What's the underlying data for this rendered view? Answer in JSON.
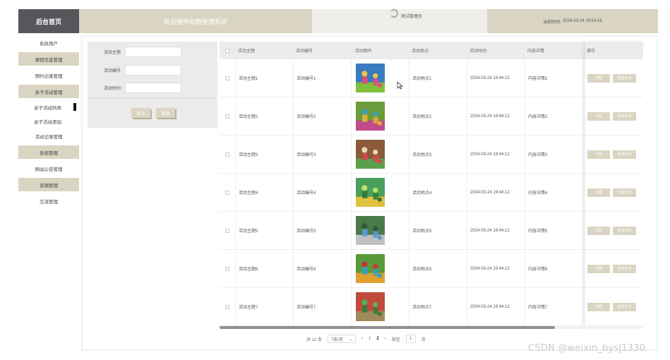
{
  "header": {
    "brand": "后台首页",
    "welcome": "欢迎使用幼教管理系统",
    "user": "测试管理员",
    "time_label": "当前时间:",
    "time_value": "2024-03-24 19:54:16"
  },
  "sidebar": {
    "items": [
      {
        "label": "系统用户",
        "style": "plain"
      },
      {
        "label": "课程信息管理",
        "style": "tan"
      },
      {
        "label": "预约记录管理",
        "style": "plain"
      },
      {
        "label": "亲子活动管理",
        "style": "tan"
      },
      {
        "label": "亲子活动列表",
        "style": "sub",
        "active": true
      },
      {
        "label": "亲子活动添加",
        "style": "sub"
      },
      {
        "label": "活动记录管理",
        "style": "plain"
      },
      {
        "label": "系统管理",
        "style": "tan"
      },
      {
        "label": "网站公告管理",
        "style": "plain"
      },
      {
        "label": "资源管理",
        "style": "tan"
      },
      {
        "label": "交流管理",
        "style": "plain"
      }
    ]
  },
  "search": {
    "fields": [
      {
        "label": "活动主题",
        "value": ""
      },
      {
        "label": "活动编号",
        "value": ""
      },
      {
        "label": "活动时间",
        "value": ""
      }
    ],
    "query_button": "查询",
    "delete_button": "删除"
  },
  "table": {
    "columns": [
      "活动主题",
      "活动编号",
      "活动图片",
      "活动地点",
      "活动时间",
      "内容详情",
      "操作"
    ],
    "rows": [
      {
        "theme": "活动主题1",
        "number": "活动编号1",
        "image_icon": "activity-photo-icon",
        "location": "活动地点1",
        "time": "2024-03-24 19:44:12",
        "detail": "内容详情1"
      },
      {
        "theme": "活动主题2",
        "number": "活动编号2",
        "image_icon": "activity-photo-icon",
        "location": "活动地点2",
        "time": "2024-03-24 19:44:12",
        "detail": "内容详情2"
      },
      {
        "theme": "活动主题3",
        "number": "活动编号3",
        "image_icon": "activity-photo-icon",
        "location": "活动地点3",
        "time": "2024-03-24 19:44:12",
        "detail": "内容详情3"
      },
      {
        "theme": "活动主题4",
        "number": "活动编号4",
        "image_icon": "activity-photo-icon",
        "location": "活动地点4",
        "time": "2024-03-24 19:44:12",
        "detail": "内容详情4"
      },
      {
        "theme": "活动主题5",
        "number": "活动编号5",
        "image_icon": "activity-photo-icon",
        "location": "活动地点5",
        "time": "2024-03-24 19:44:12",
        "detail": "内容详情5"
      },
      {
        "theme": "活动主题6",
        "number": "活动编号6",
        "image_icon": "activity-photo-icon",
        "location": "活动地点6",
        "time": "2024-03-24 19:44:12",
        "detail": "内容详情6"
      },
      {
        "theme": "活动主题7",
        "number": "活动编号7",
        "image_icon": "activity-photo-icon",
        "location": "活动地点7",
        "time": "2024-03-24 19:44:12",
        "detail": "内容详情7"
      }
    ],
    "op_detail": "详情",
    "op_view": "查看评论"
  },
  "pager": {
    "total": "共 12 条",
    "page_size": "7条/页",
    "prev": "‹",
    "pages": [
      "1",
      "2"
    ],
    "current": "2",
    "next": "›",
    "goto_label": "前往",
    "goto_value": "1",
    "page_suffix": "页"
  },
  "watermark": "CSDN @weixin_bysj1330",
  "colors": {
    "accent_tan": "#dad4c2",
    "brand_dark": "#56565b",
    "header_light": "#efeeea"
  }
}
